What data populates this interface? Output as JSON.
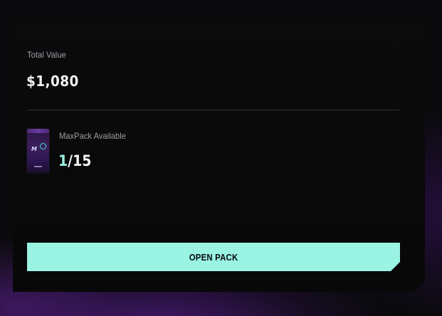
{
  "summary": {
    "total_label": "Total Value",
    "total_value": "$1,080"
  },
  "pack": {
    "label": "MaxPack Available",
    "current": "1",
    "separator": "/",
    "total": "15",
    "thumbnail_icon": "maxpack-icon"
  },
  "actions": {
    "open_label": "OPEN PACK"
  },
  "colors": {
    "accent": "#9af3e3",
    "card_background": "#080809",
    "page_background": "#0a0a0c",
    "glow": "#5c1e96"
  }
}
